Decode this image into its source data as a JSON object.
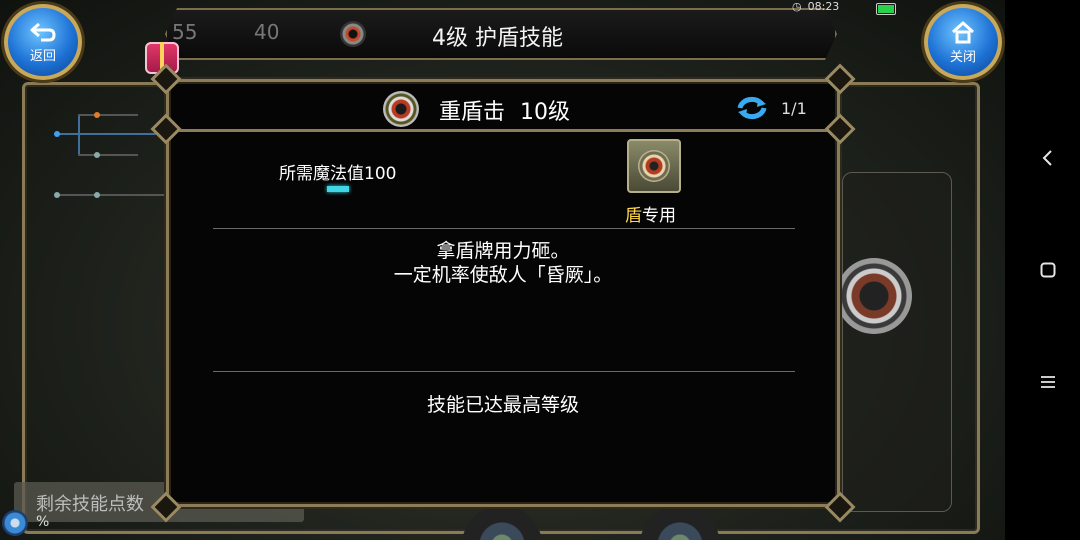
{
  "status_bar": {
    "time": "08:23"
  },
  "top_ghost": {
    "value_a": "55",
    "value_b": "40"
  },
  "title_bar": {
    "title": "4级 护盾技能"
  },
  "buttons": {
    "back_label": "返回",
    "close_label": "关闭"
  },
  "dialog": {
    "skill_name": "重盾击",
    "skill_level": "10级",
    "page": "1/1",
    "mp_requirement": "所需魔法值100",
    "weapon_highlight": "盾",
    "weapon_suffix": "专用",
    "description_line1": "拿盾牌用力砸。",
    "description_line2": "一定机率使敌人「昏厥」。",
    "max_level_text": "技能已达最高等级"
  },
  "background": {
    "skill_points_label": "剩余技能点数",
    "percent_text": "%"
  },
  "icons": [
    "back-arrow-icon",
    "home-icon",
    "gift-icon",
    "shield-skill-icon",
    "refresh-icon",
    "shield-weapon-icon",
    "nav-back-icon",
    "nav-home-icon",
    "nav-menu-icon"
  ],
  "colors": {
    "accent_gold": "#8c7c58",
    "mp_cyan": "#3fd6e6",
    "highlight_yellow": "#ffd84a",
    "button_blue": "#1e73d6"
  }
}
